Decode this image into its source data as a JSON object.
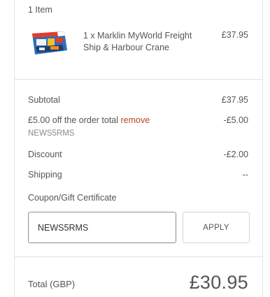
{
  "cart": {
    "item_count": "1 Item",
    "item": {
      "name": "1 x Marklin MyWorld Freight Ship & Harbour Crane",
      "price": "£37.95",
      "thumbnail_icon": "product-thumbnail"
    }
  },
  "summary": {
    "subtotal_label": "Subtotal",
    "subtotal_value": "£37.95",
    "promo_label": "£5.00 off the order total",
    "promo_remove": "remove",
    "promo_value": "-£5.00",
    "promo_code": "NEWS5RMS",
    "discount_label": "Discount",
    "discount_value": "-£2.00",
    "shipping_label": "Shipping",
    "shipping_value": "--"
  },
  "coupon": {
    "label": "Coupon/Gift Certificate",
    "value": "NEWS5RMS",
    "apply_label": "APPLY"
  },
  "total": {
    "label": "Total (GBP)",
    "value": "£30.95"
  },
  "colors": {
    "remove_link": "#b5461c",
    "border": "#e3e3e3"
  }
}
